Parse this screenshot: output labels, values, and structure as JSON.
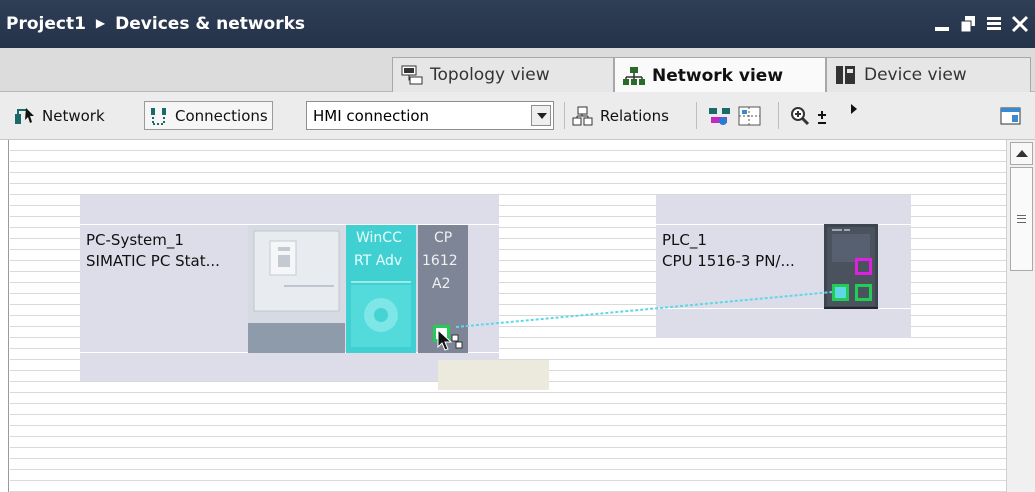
{
  "titlebar": {
    "project": "Project1",
    "section": "Devices & networks"
  },
  "tabs": [
    {
      "label": "Topology view",
      "icon": "topology-icon",
      "active": false
    },
    {
      "label": "Network view",
      "icon": "network-view-icon",
      "active": true
    },
    {
      "label": "Device view",
      "icon": "device-view-icon",
      "active": false
    }
  ],
  "toolbar": {
    "network_label": "Network",
    "connections_label": "Connections",
    "connection_type": "HMI connection",
    "relations_label": "Relations"
  },
  "devices": {
    "pc": {
      "name": "PC-System_1",
      "type": "SIMATIC PC Stat...",
      "wincc_line1": "WinCC",
      "wincc_line2": "RT Adv",
      "cp_line1": "CP",
      "cp_line2": "1612",
      "cp_line3": "A2"
    },
    "plc": {
      "name": "PLC_1",
      "type": "CPU 1516-3 PN/..."
    }
  },
  "colors": {
    "titlebar": "#2a3950",
    "device_bg": "#dcdde8",
    "wincc_teal": "#3fcfd0",
    "connection_line": "#5fd7e6",
    "port_green": "#22cc55",
    "port_magenta": "#dd22dd"
  }
}
